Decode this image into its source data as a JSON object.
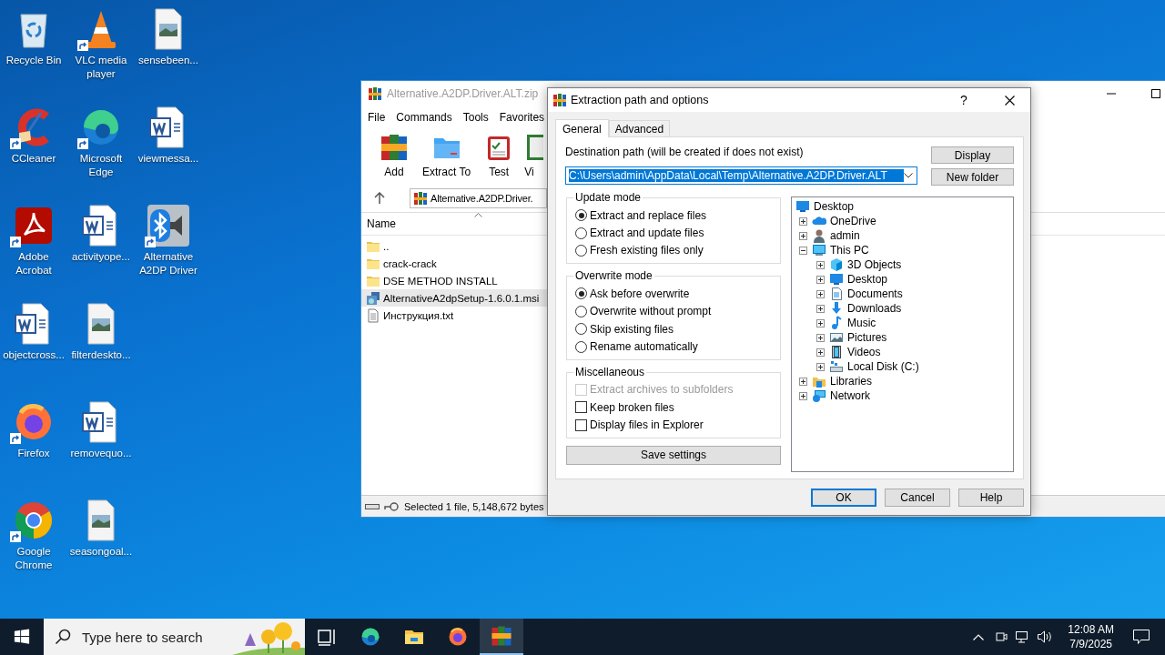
{
  "desktop": {
    "icons": [
      {
        "label": "Recycle Bin",
        "kind": "recycle",
        "shortcut": false
      },
      {
        "label": "CCleaner",
        "kind": "ccleaner",
        "shortcut": true
      },
      {
        "label": "Adobe Acrobat",
        "kind": "acrobat",
        "shortcut": true
      },
      {
        "label": "objectcross...",
        "kind": "word",
        "shortcut": false
      },
      {
        "label": "Firefox",
        "kind": "firefox",
        "shortcut": true
      },
      {
        "label": "Google Chrome",
        "kind": "chrome",
        "shortcut": true
      },
      {
        "label": "VLC media player",
        "kind": "vlc",
        "shortcut": true
      },
      {
        "label": "Microsoft Edge",
        "kind": "edge",
        "shortcut": true
      },
      {
        "label": "activityope...",
        "kind": "word",
        "shortcut": false
      },
      {
        "label": "filterdeskto...",
        "kind": "image",
        "shortcut": false
      },
      {
        "label": "removequo...",
        "kind": "word",
        "shortcut": false
      },
      {
        "label": "seasongoal...",
        "kind": "image",
        "shortcut": false
      },
      {
        "label": "sensebeen...",
        "kind": "image",
        "shortcut": false
      },
      {
        "label": "viewmessa...",
        "kind": "word",
        "shortcut": false
      },
      {
        "label": "Alternative A2DP Driver",
        "kind": "bluetooth",
        "shortcut": true
      }
    ]
  },
  "archiver_window": {
    "title": "Alternative.A2DP.Driver.ALT.zip",
    "active": false,
    "menu": [
      "File",
      "Commands",
      "Tools",
      "Favorites"
    ],
    "toolbar": [
      {
        "label": "Add",
        "kind": "add"
      },
      {
        "label": "Extract To",
        "kind": "extract"
      },
      {
        "label": "Test",
        "kind": "test"
      },
      {
        "label": "Vi",
        "kind": "view"
      }
    ],
    "address": "Alternative.A2DP.Driver.",
    "columns": [
      "Name"
    ],
    "files": [
      {
        "name": "..",
        "kind": "folder",
        "selected": false
      },
      {
        "name": "crack-crack",
        "kind": "folder",
        "selected": false
      },
      {
        "name": "DSE METHOD INSTALL",
        "kind": "folder",
        "selected": false
      },
      {
        "name": "AlternativeA2dpSetup-1.6.0.1.msi",
        "kind": "installer",
        "selected": true
      },
      {
        "name": "Инструкция.txt",
        "kind": "text",
        "selected": false
      }
    ],
    "status": "Selected 1 file, 5,148,672 bytes"
  },
  "dialog": {
    "title": "Extraction path and options",
    "help_glyph": "?",
    "tabs": [
      {
        "label": "General",
        "selected": true
      },
      {
        "label": "Advanced",
        "selected": false
      }
    ],
    "destination_label": "Destination path (will be created if does not exist)",
    "destination_value": "C:\\Users\\admin\\AppData\\Local\\Temp\\Alternative.A2DP.Driver.ALT",
    "destination_text_selected": true,
    "side_buttons": [
      "Display",
      "New folder"
    ],
    "groups": [
      {
        "title": "Update mode",
        "kind": "radio",
        "options": [
          {
            "label": "Extract and replace files",
            "selected": true
          },
          {
            "label": "Extract and update files",
            "selected": false
          },
          {
            "label": "Fresh existing files only",
            "selected": false
          }
        ]
      },
      {
        "title": "Overwrite mode",
        "kind": "radio",
        "options": [
          {
            "label": "Ask before overwrite",
            "selected": true
          },
          {
            "label": "Overwrite without prompt",
            "selected": false
          },
          {
            "label": "Skip existing files",
            "selected": false
          },
          {
            "label": "Rename automatically",
            "selected": false
          }
        ]
      },
      {
        "title": "Miscellaneous",
        "kind": "checkbox",
        "options": [
          {
            "label": "Extract archives to subfolders",
            "checked": false,
            "disabled": true
          },
          {
            "label": "Keep broken files",
            "checked": false,
            "disabled": false
          },
          {
            "label": "Display files in Explorer",
            "checked": false,
            "disabled": false
          }
        ]
      }
    ],
    "save_button": "Save settings",
    "tree": [
      {
        "label": "Desktop",
        "kind": "desktop",
        "children": [
          {
            "label": "OneDrive",
            "kind": "cloud",
            "expanded": false
          },
          {
            "label": "admin",
            "kind": "user",
            "expanded": false
          },
          {
            "label": "This PC",
            "kind": "computer",
            "expanded": true,
            "children": [
              {
                "label": "3D Objects",
                "kind": "cube",
                "expanded": false
              },
              {
                "label": "Desktop",
                "kind": "desktop",
                "expanded": false
              },
              {
                "label": "Documents",
                "kind": "documents",
                "expanded": false
              },
              {
                "label": "Downloads",
                "kind": "downloads",
                "expanded": false
              },
              {
                "label": "Music",
                "kind": "music",
                "expanded": false
              },
              {
                "label": "Pictures",
                "kind": "pictures",
                "expanded": false
              },
              {
                "label": "Videos",
                "kind": "videos",
                "expanded": false
              },
              {
                "label": "Local Disk (C:)",
                "kind": "disk",
                "expanded": false
              }
            ]
          },
          {
            "label": "Libraries",
            "kind": "libraries",
            "expanded": false
          },
          {
            "label": "Network",
            "kind": "network",
            "expanded": false
          }
        ]
      }
    ],
    "buttons": [
      {
        "label": "OK",
        "default": true
      },
      {
        "label": "Cancel",
        "default": false
      },
      {
        "label": "Help",
        "default": false
      }
    ]
  },
  "taskbar": {
    "search_placeholder": "Type here to search",
    "apps": [
      {
        "kind": "taskview",
        "active": false
      },
      {
        "kind": "edge",
        "active": false
      },
      {
        "kind": "explorer",
        "active": false
      },
      {
        "kind": "firefox",
        "active": false
      },
      {
        "kind": "archiver",
        "active": true
      }
    ],
    "time": "12:08 AM",
    "date": "7/9/2025"
  }
}
